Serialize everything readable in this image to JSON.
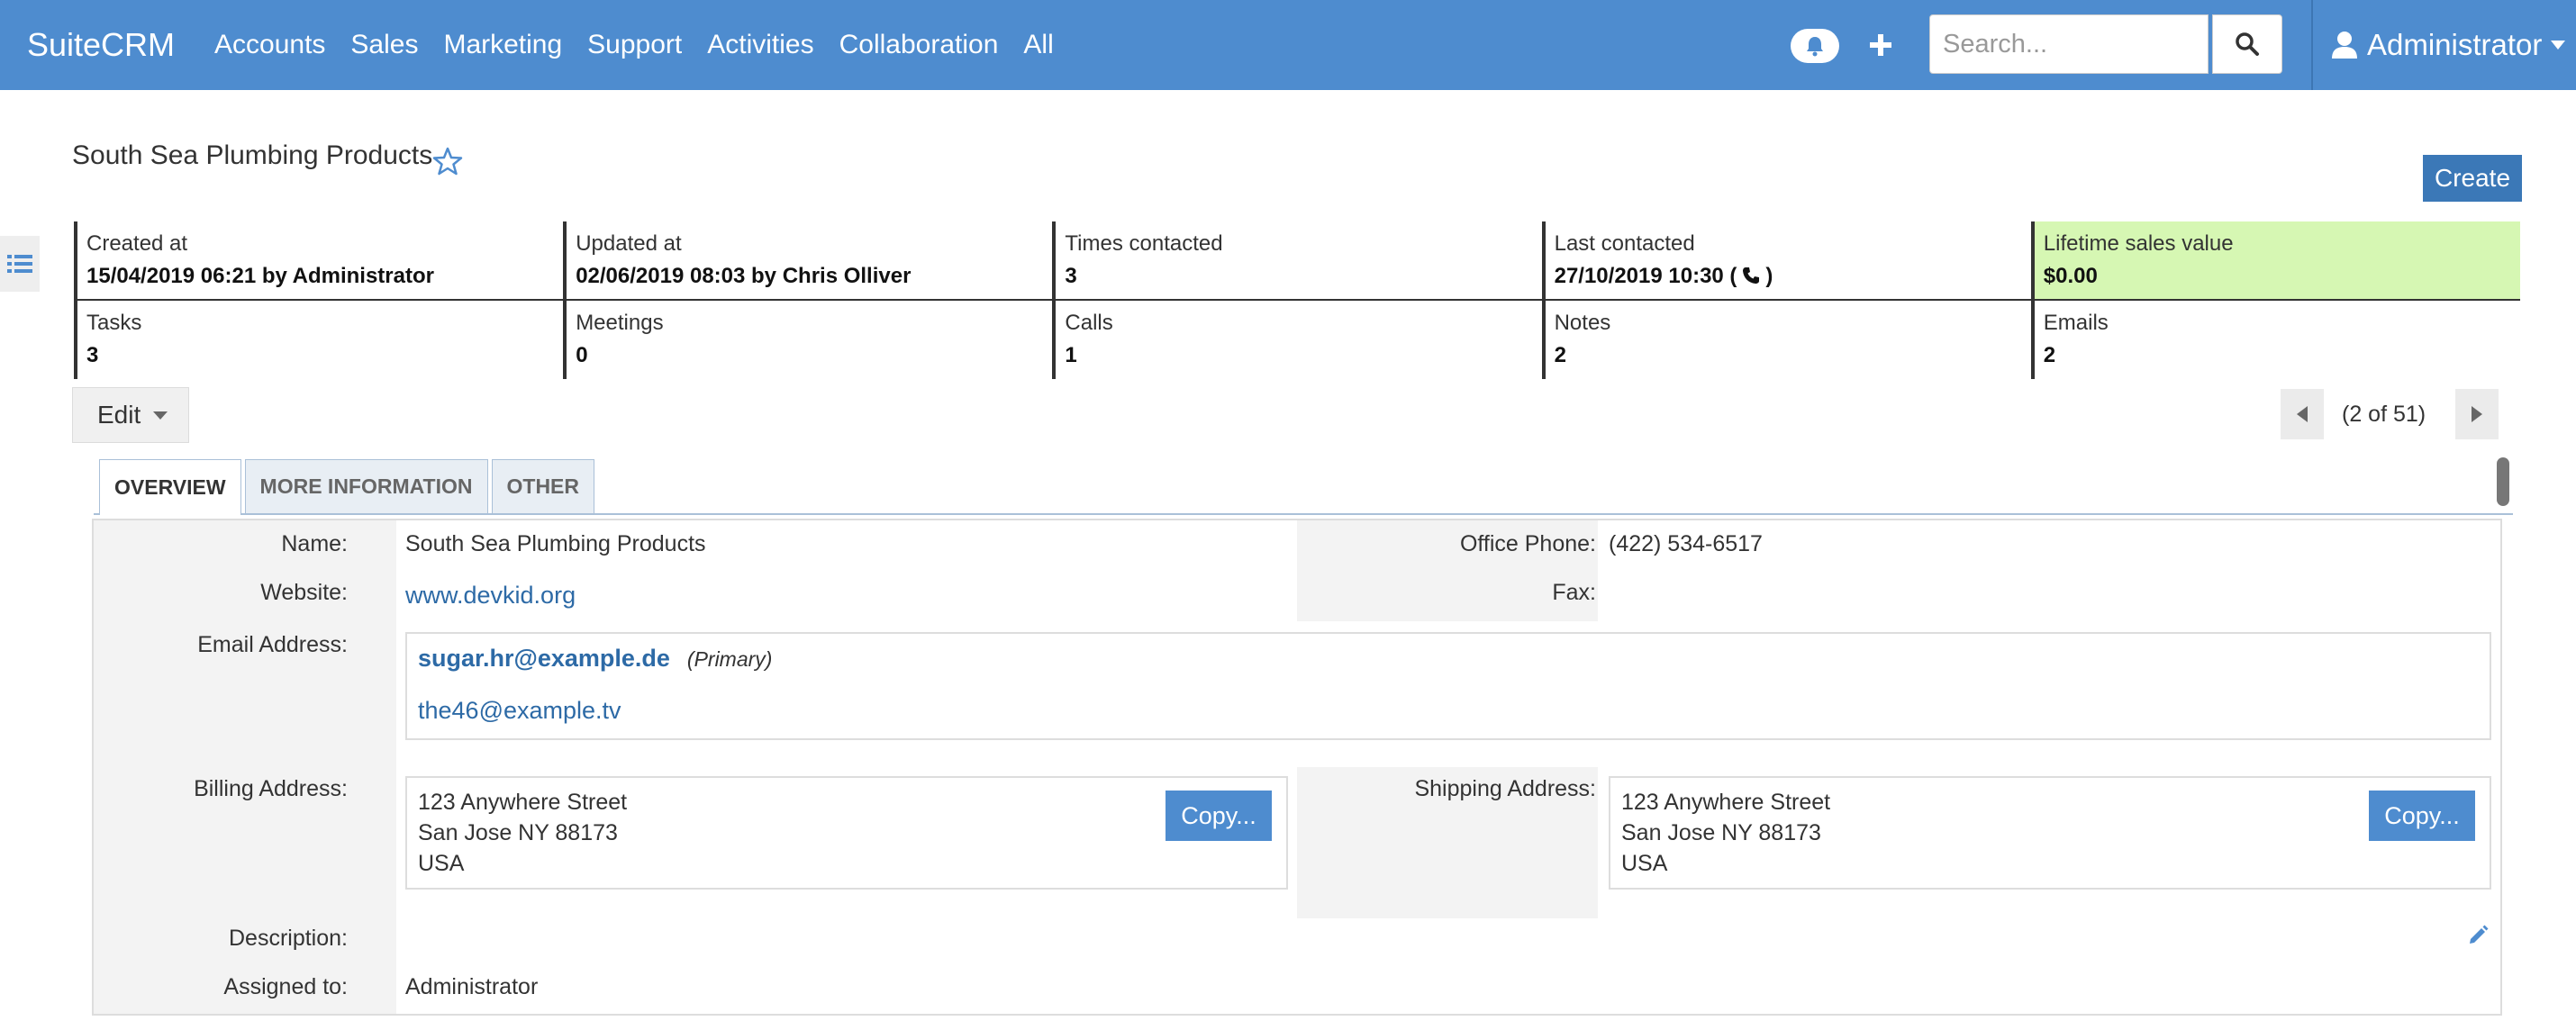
{
  "app": {
    "brand": "SuiteCRM"
  },
  "nav": {
    "items": [
      "Accounts",
      "Sales",
      "Marketing",
      "Support",
      "Activities",
      "Collaboration",
      "All"
    ],
    "search_placeholder": "Search...",
    "user_name": "Administrator",
    "icons": {
      "notifications": "bell-icon",
      "quick_create": "plus-icon",
      "search": "magnifier-icon",
      "user": "user-icon"
    }
  },
  "record": {
    "title": "South Sea Plumbing Products",
    "create_label": "Create"
  },
  "summary": [
    {
      "label": "Created at",
      "value": "15/04/2019 06:21 by Administrator"
    },
    {
      "label": "Updated at",
      "value": "02/06/2019 08:03 by Chris Olliver"
    },
    {
      "label": "Times contacted",
      "value": "3"
    },
    {
      "label": "Last contacted",
      "value": "27/10/2019 10:30 (",
      "value_suffix": ")"
    },
    {
      "label": "Lifetime sales value",
      "value": "$0.00"
    },
    {
      "label": "Tasks",
      "value": "3"
    },
    {
      "label": "Meetings",
      "value": "0"
    },
    {
      "label": "Calls",
      "value": "1"
    },
    {
      "label": "Notes",
      "value": "2"
    },
    {
      "label": "Emails",
      "value": "2"
    }
  ],
  "colors": {
    "nav": "#4e8ccf",
    "highlight": "#d6f7b3",
    "link": "#2d6aa6",
    "button": "#3b78b7"
  },
  "actions": {
    "edit_label": "Edit"
  },
  "pagination": {
    "text": "(2 of 51)"
  },
  "tabs": [
    "OVERVIEW",
    "MORE INFORMATION",
    "OTHER"
  ],
  "details": {
    "name_label": "Name:",
    "name": "South Sea Plumbing Products",
    "office_phone_label": "Office Phone:",
    "office_phone": "(422) 534-6517",
    "website_label": "Website:",
    "website": "www.devkid.org",
    "fax_label": "Fax:",
    "fax": "",
    "email_label": "Email Address:",
    "email_primary": "sugar.hr@example.de",
    "email_primary_tag": "(Primary)",
    "email_secondary": "the46@example.tv",
    "billing_label": "Billing Address:",
    "billing_street": "123 Anywhere Street",
    "billing_city": "San Jose NY  88173",
    "billing_country": "USA",
    "shipping_label": "Shipping Address:",
    "shipping_street": "123 Anywhere Street",
    "shipping_city": "San Jose NY  88173",
    "shipping_country": "USA",
    "copy_label": "Copy...",
    "description_label": "Description:",
    "description": "",
    "assigned_label": "Assigned to:",
    "assigned_to": "Administrator"
  }
}
